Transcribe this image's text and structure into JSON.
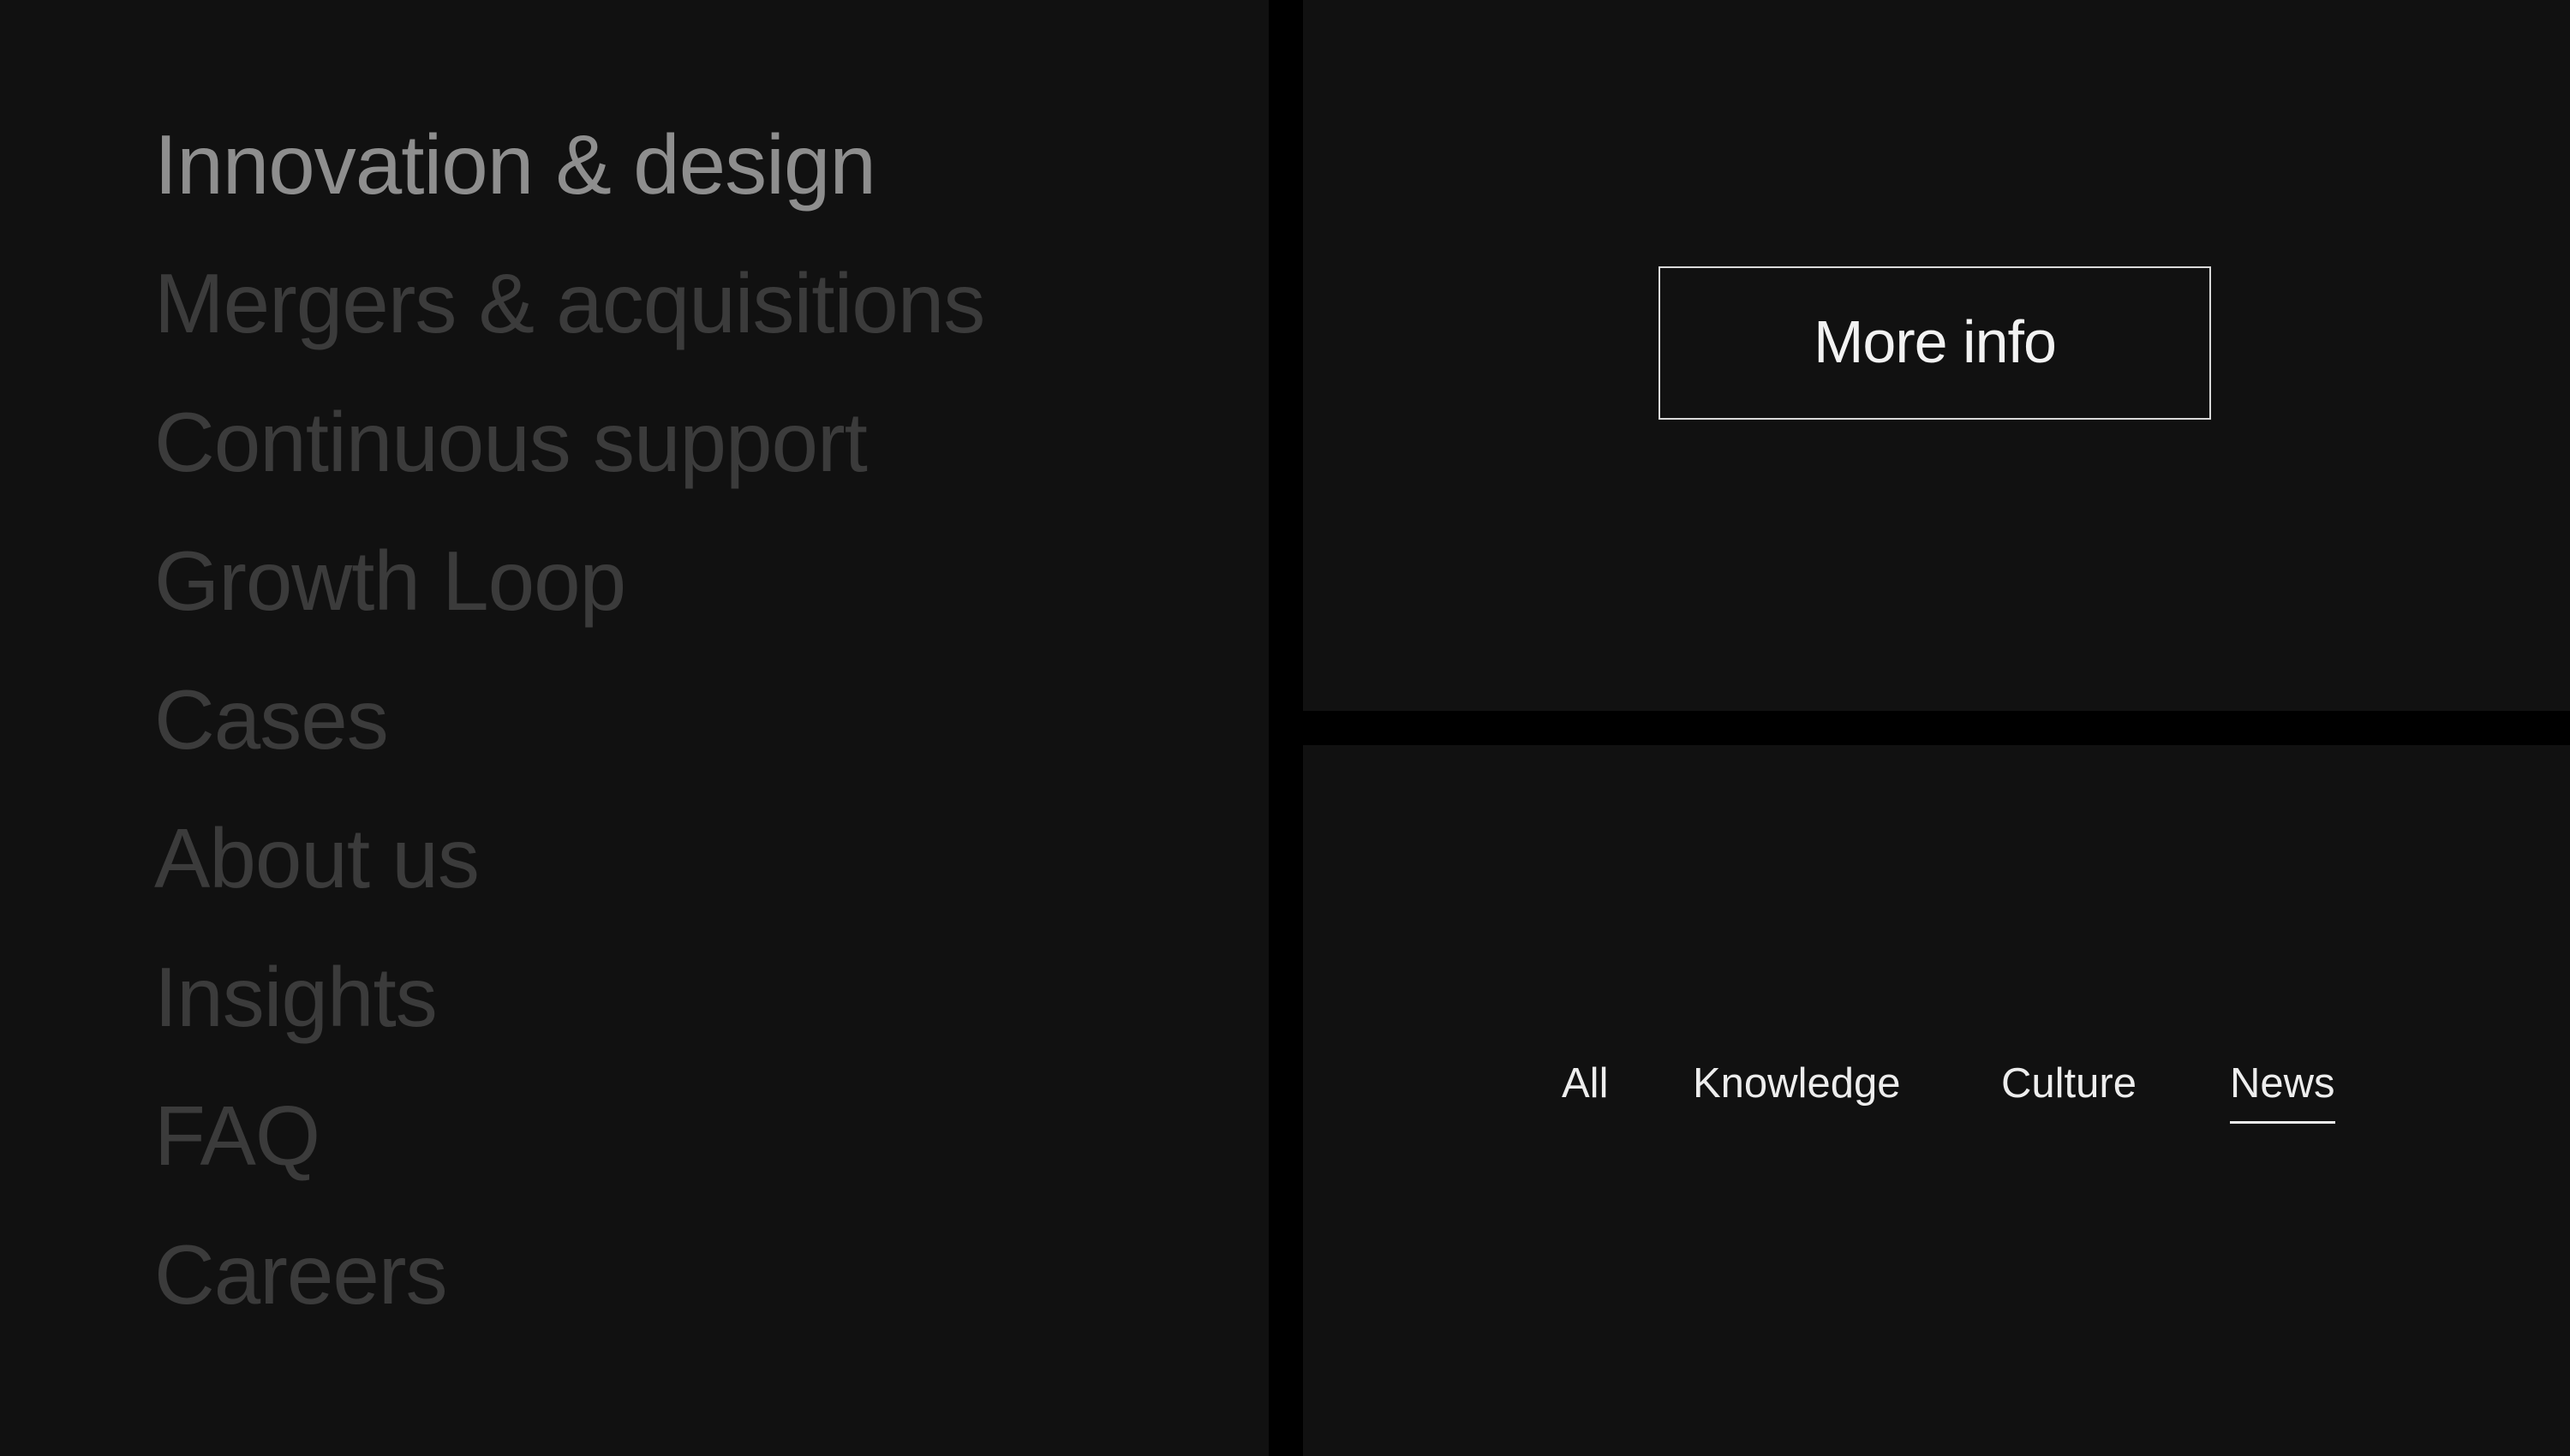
{
  "menu": {
    "items": [
      {
        "label": "Innovation & design",
        "active": true
      },
      {
        "label": "Mergers & acquisitions",
        "active": false
      },
      {
        "label": "Continuous support",
        "active": false
      },
      {
        "label": "Growth Loop",
        "active": false
      },
      {
        "label": "Cases",
        "active": false
      },
      {
        "label": "About us",
        "active": false
      },
      {
        "label": "Insights",
        "active": false
      },
      {
        "label": "FAQ",
        "active": false
      },
      {
        "label": "Careers",
        "active": false
      }
    ]
  },
  "cta": {
    "label": "More info"
  },
  "filters": {
    "tabs": [
      {
        "label": "All",
        "active": false
      },
      {
        "label": "Knowledge",
        "active": false
      },
      {
        "label": "Culture",
        "active": false
      },
      {
        "label": "News",
        "active": true
      }
    ]
  },
  "colors": {
    "page_background": "#000000",
    "panel_background": "#111111",
    "menu_active": "#8e8e8e",
    "menu_inactive": "#3b3b3b",
    "text_light": "#f2f2f2"
  }
}
